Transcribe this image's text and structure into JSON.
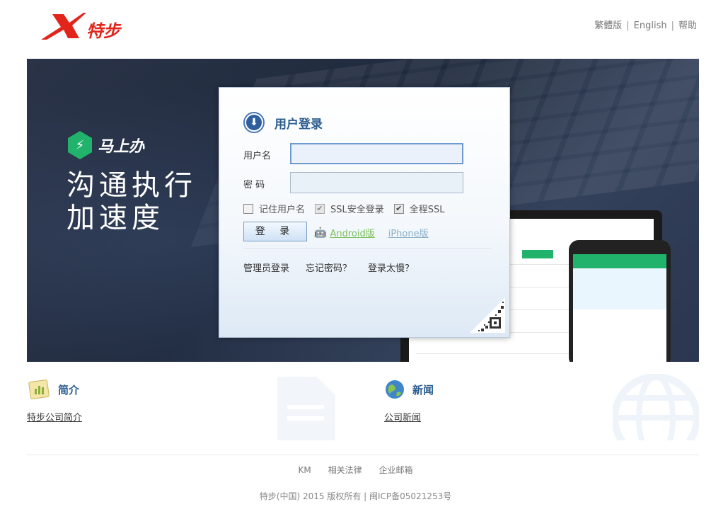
{
  "header": {
    "logo_text": "特步",
    "links": [
      "繁體版",
      "English",
      "帮助"
    ]
  },
  "banner": {
    "brand": "马上办",
    "slogan_line1": "沟通执行",
    "slogan_line2": "加速度"
  },
  "login": {
    "title": "用户登录",
    "username_label": "用户名",
    "username_value": "",
    "password_label": "密 码",
    "password_value": "",
    "remember_label": "记住用户名",
    "remember_checked": false,
    "ssl_label": "SSL安全登录",
    "ssl_checked": true,
    "fullssl_label": "全程SSL",
    "fullssl_checked": true,
    "submit_label": "登 录",
    "android_label": "Android版",
    "iphone_label": "iPhone版",
    "admin_link": "管理员登录",
    "forgot_link": "忘记密码？",
    "slow_link": "登录太慢？"
  },
  "sections": {
    "intro_title": "简介",
    "intro_link": "特步公司简介",
    "news_title": "新闻",
    "news_link": "公司新闻"
  },
  "footer": {
    "links": [
      "KM",
      "相关法律",
      "企业邮箱"
    ],
    "copyright": "特步(中国) 2015 版权所有 | 闽ICP备05021253号"
  },
  "colors": {
    "brand_red": "#e1251b",
    "accent_blue": "#2b5d8f",
    "banner_dark": "#222c3f",
    "green": "#21b36b"
  }
}
